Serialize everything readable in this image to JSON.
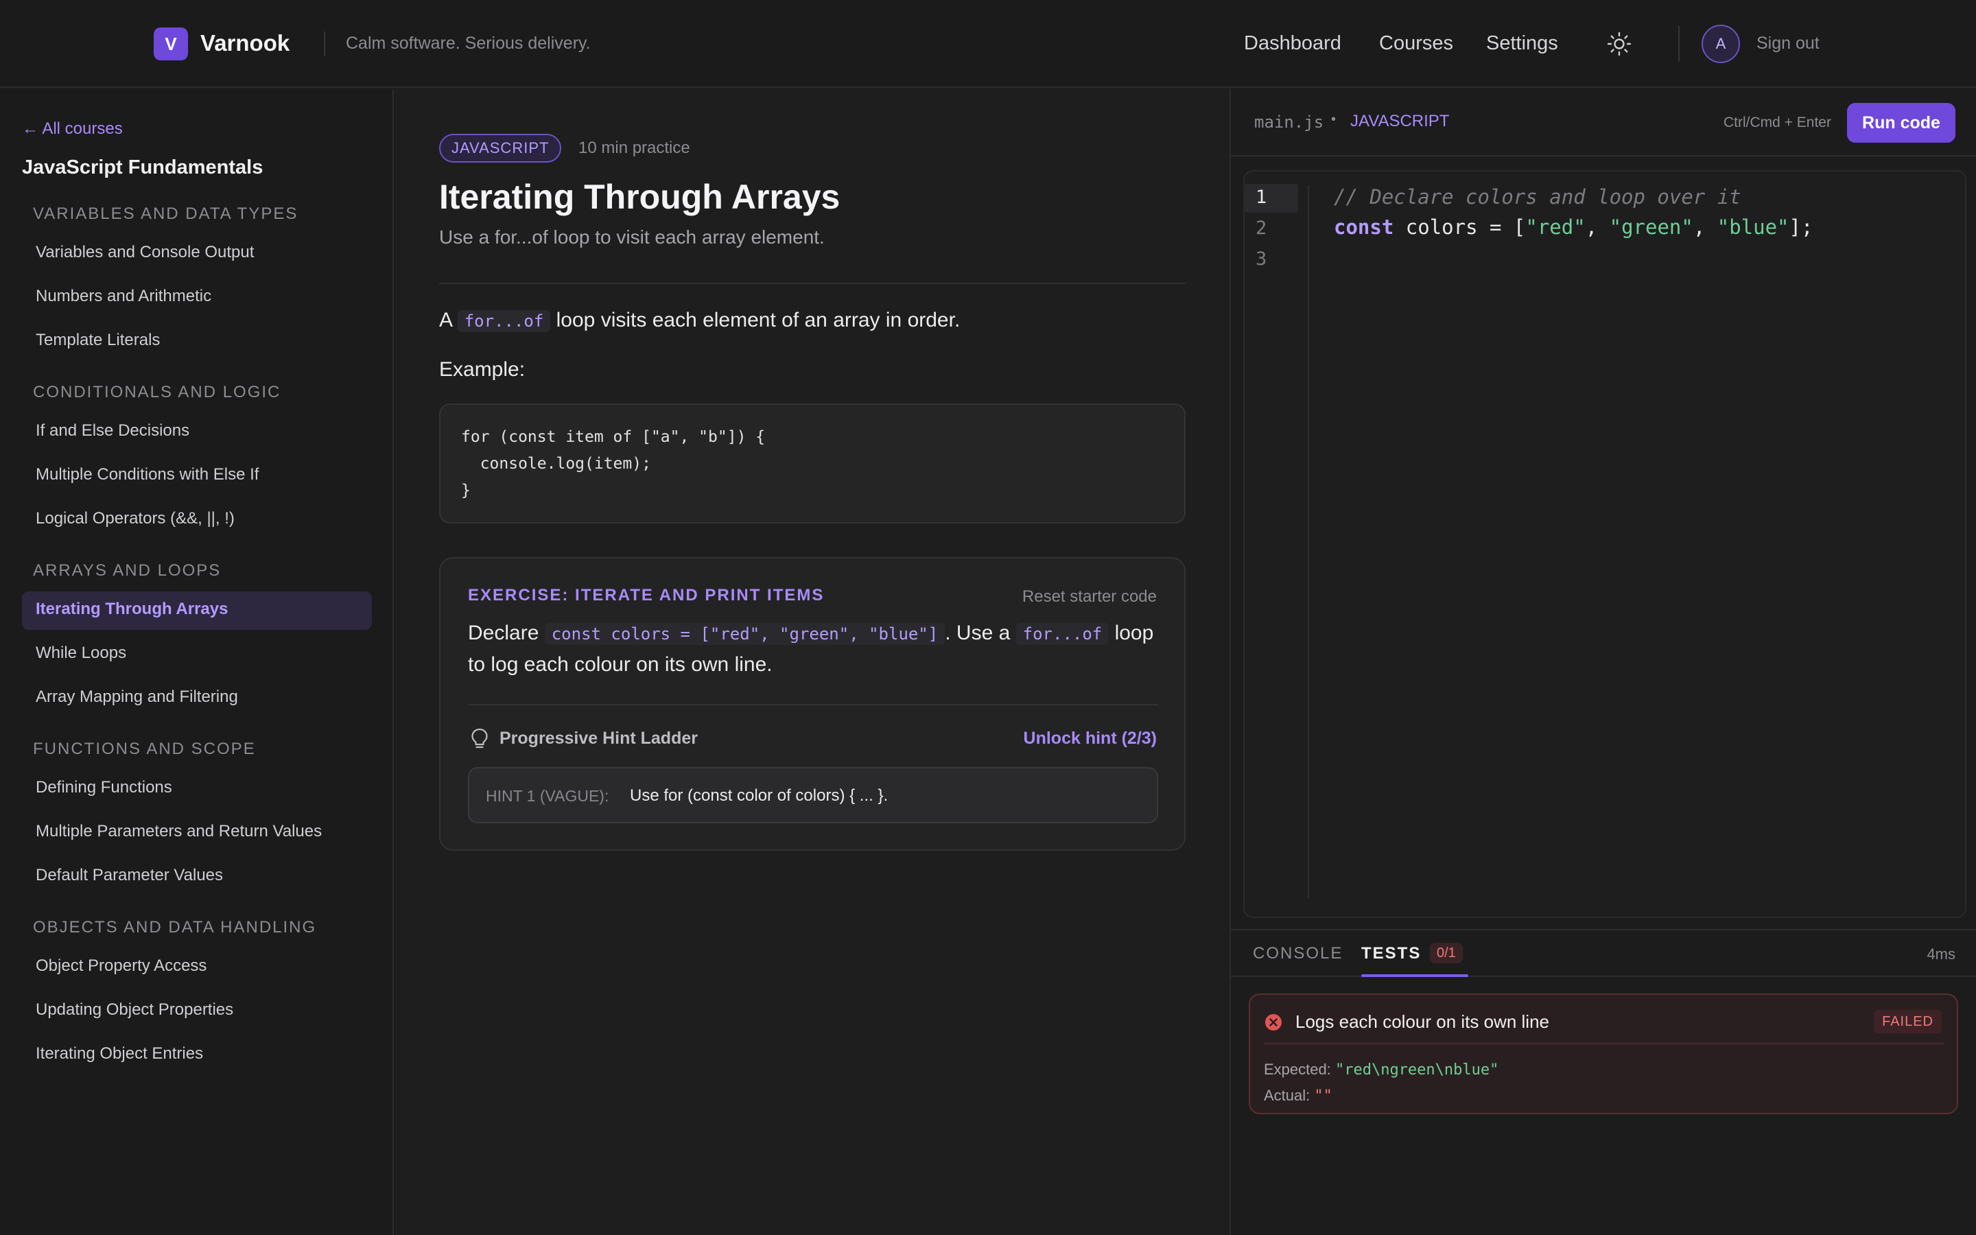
{
  "header": {
    "logo_letter": "V",
    "brand": "Varnook",
    "tagline": "Calm software. Serious delivery.",
    "nav": [
      "Dashboard",
      "Courses",
      "Settings"
    ],
    "avatar_initial": "A",
    "sign_out": "Sign out",
    "theme_icon": "sun-icon"
  },
  "sidebar": {
    "back_link": "← All courses",
    "course_title": "JavaScript Fundamentals",
    "sections": [
      {
        "title": "VARIABLES AND DATA TYPES",
        "items": [
          "Variables and Console Output",
          "Numbers and Arithmetic",
          "Template Literals"
        ]
      },
      {
        "title": "CONDITIONALS AND LOGIC",
        "items": [
          "If and Else Decisions",
          "Multiple Conditions with Else If",
          "Logical Operators (&&, ||, !)"
        ]
      },
      {
        "title": "ARRAYS AND LOOPS",
        "items": [
          "Iterating Through Arrays",
          "While Loops",
          "Array Mapping and Filtering"
        ]
      },
      {
        "title": "FUNCTIONS AND SCOPE",
        "items": [
          "Defining Functions",
          "Multiple Parameters and Return Values",
          "Default Parameter Values"
        ]
      },
      {
        "title": "OBJECTS AND DATA HANDLING",
        "items": [
          "Object Property Access",
          "Updating Object Properties",
          "Iterating Object Entries"
        ]
      }
    ],
    "active_item": "Iterating Through Arrays"
  },
  "lesson": {
    "language_badge": "JAVASCRIPT",
    "duration": "10 min practice",
    "title": "Iterating Through Arrays",
    "subtitle": "Use a for...of loop to visit each array element.",
    "intro_before": "A",
    "intro_code": "for...of",
    "intro_after": "loop visits each element of an array in order.",
    "example_label": "Example:",
    "example_code": "for (const item of [\"a\", \"b\"]) {\n  console.log(item);\n}"
  },
  "exercise": {
    "title": "EXERCISE: ITERATE AND PRINT ITEMS",
    "reset": "Reset starter code",
    "text_1": "Declare",
    "code_1": "const colors = [\"red\", \"green\", \"blue\"]",
    "text_2": ". Use a",
    "code_2": "for...of",
    "text_3": "loop",
    "text_4": "to log each colour on its own line.",
    "hint_ladder": "Progressive Hint Ladder",
    "unlock_hint": "Unlock hint (2/3)",
    "hint_tag": "HINT 1 (VAGUE):",
    "hint_text": "Use for (const color of colors) { ... }."
  },
  "editor": {
    "file_name": "main.js",
    "separator": "•",
    "language": "JAVASCRIPT",
    "shortcut": "Ctrl/Cmd + Enter",
    "run_label": "Run code",
    "line_numbers": [
      "1",
      "2",
      "3"
    ],
    "line1": "// Declare colors and loop over it",
    "line2": {
      "kw": "const",
      "p1": " colors = [",
      "s1": "\"red\"",
      "c1": ", ",
      "s2": "\"green\"",
      "c2": ", ",
      "s3": "\"blue\"",
      "end": "];"
    }
  },
  "output": {
    "tab_console": "CONSOLE",
    "tab_tests": "TESTS",
    "tests_count": "0/1",
    "time": "4ms",
    "test_name": "Logs each colour on its own line",
    "status": "FAILED",
    "expected_label": "Expected:",
    "expected_value": "\"red\\ngreen\\nblue\"",
    "actual_label": "Actual:",
    "actual_value": "\"\""
  },
  "colors": {
    "accent": "#6f48dc",
    "accent_text": "#a88bfa",
    "fail": "#f07a7a",
    "success": "#6fcf97"
  }
}
